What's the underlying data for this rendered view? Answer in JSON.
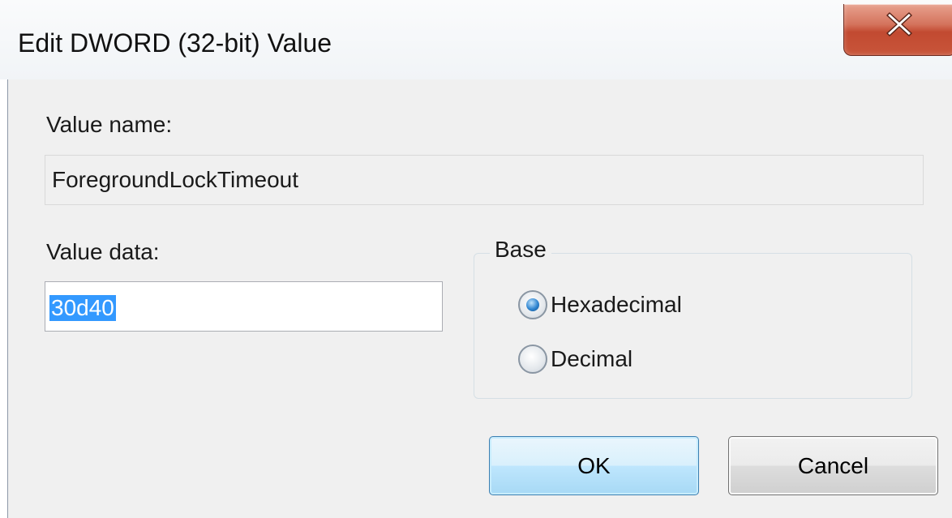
{
  "window": {
    "title": "Edit DWORD (32-bit) Value",
    "close_icon": "close-icon"
  },
  "value_name": {
    "label": "Value name:",
    "value": "ForegroundLockTimeout"
  },
  "value_data": {
    "label": "Value data:",
    "value": "30d40"
  },
  "base": {
    "title": "Base",
    "options": [
      {
        "label": "Hexadecimal",
        "selected": true
      },
      {
        "label": "Decimal",
        "selected": false
      }
    ]
  },
  "buttons": {
    "ok_label": "OK",
    "cancel_label": "Cancel"
  },
  "colors": {
    "selection": "#3399ff",
    "dialog_bg": "#f0f0f0",
    "close_button": "#c24a31"
  }
}
